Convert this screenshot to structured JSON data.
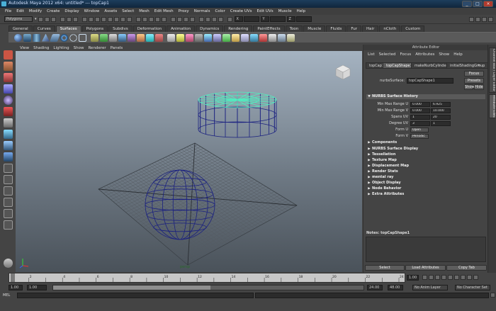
{
  "window": {
    "title": "Autodesk Maya 2012 x64: untitled*  ---  topCap1"
  },
  "menubar": [
    "File",
    "Edit",
    "Modify",
    "Create",
    "Display",
    "Window",
    "Assets",
    "Select",
    "Mesh",
    "Edit Mesh",
    "Proxy",
    "Normals",
    "Color",
    "Create UVs",
    "Edit UVs",
    "Muscle",
    "Help"
  ],
  "statusline": {
    "menuset": "Polygons",
    "field_x": "X",
    "field_y": "Y",
    "field_z": "Z"
  },
  "shelf_tabs": [
    "General",
    "Curves",
    "Surfaces",
    "Polygons",
    "Subdivs",
    "Deformation",
    "Animation",
    "Dynamics",
    "Rendering",
    "PaintEffects",
    "Toon",
    "Muscle",
    "Fluids",
    "Fur",
    "Hair",
    "nCloth",
    "Custom"
  ],
  "shelf_active": "Surfaces",
  "viewport_menu": [
    "View",
    "Shading",
    "Lighting",
    "Show",
    "Renderer",
    "Panels"
  ],
  "viewport": {
    "hud_label": "persp"
  },
  "attribute_editor": {
    "header": "Attribute Editor",
    "menu": [
      "List",
      "Selected",
      "Focus",
      "Attributes",
      "Show",
      "Help"
    ],
    "tabs": [
      "topCap1",
      "topCapShape1",
      "makeNurbCylinder1",
      "initialShadingGroup"
    ],
    "active_tab": "topCapShape1",
    "nurbs_label": "nurbsSurface:",
    "nurbs_value": "topCapShape1",
    "focus_button": "Focus",
    "presets_button": "Presets",
    "show_button": "Show",
    "hide_button": "Hide",
    "history_section": "NURBS Surface History",
    "rows": [
      {
        "label": "Min Max Range U",
        "v1": "0.000",
        "v2": "6.925"
      },
      {
        "label": "Min Max Range V",
        "v1": "0.000",
        "v2": "10.000"
      },
      {
        "label": "Spans UV",
        "v1": "1",
        "v2": "20"
      },
      {
        "label": "Degree UV",
        "v1": "3",
        "v2": "1"
      }
    ],
    "form_u_label": "Form U",
    "form_u_value": "Open",
    "form_v_label": "Form V",
    "form_v_value": "Periodic",
    "sections": [
      "Components",
      "NURBS Surface Display",
      "Tessellation",
      "Texture Map",
      "Displacement Map",
      "Render Stats",
      "mental ray",
      "Object Display",
      "Node Behavior",
      "Extra Attributes"
    ],
    "notes_label": "Notes: topCapShape1",
    "bottom_buttons": [
      "Select",
      "Load Attributes",
      "Copy Tab"
    ]
  },
  "side_tabs": [
    "Channel Box / Layer Editor",
    "Attribute Editor"
  ],
  "time_slider": {
    "ticks": [
      "1",
      "2",
      "4",
      "6",
      "8",
      "10",
      "12",
      "14",
      "16",
      "18",
      "20",
      "22",
      "24"
    ],
    "current_frame": "1.00"
  },
  "range": {
    "start": "1.00",
    "inner_start": "1.00",
    "current": "1",
    "inner_end": "24",
    "end_a": "24.00",
    "end_b": "48.00",
    "anim_layer": "No Anim Layer",
    "char_set": "No Character Set"
  },
  "cmdline": {
    "label": "MEL"
  },
  "colors": {
    "wire_blue": "#1a2080",
    "wire_selected": "#4df2c0",
    "grid": "#555b62"
  }
}
